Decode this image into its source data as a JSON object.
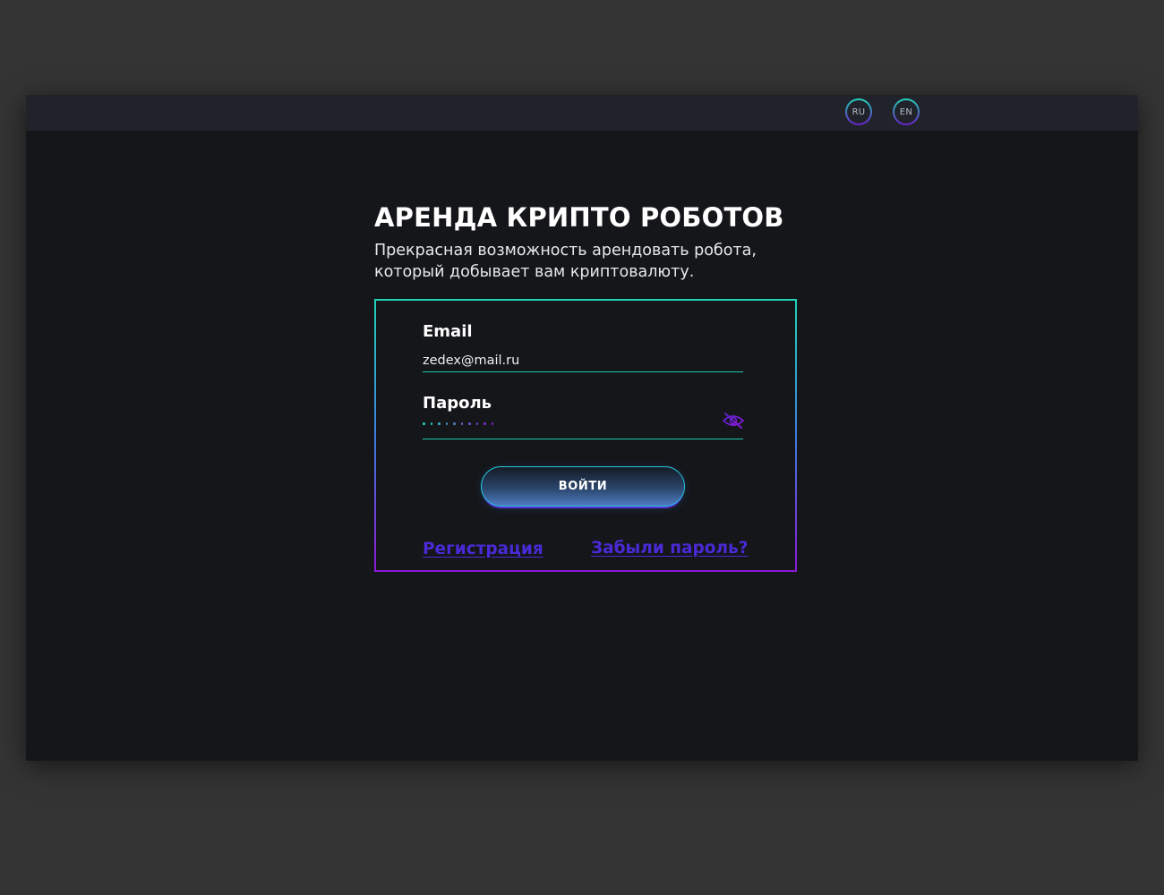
{
  "header": {
    "languages": [
      "RU",
      "EN"
    ]
  },
  "hero": {
    "title": "АРЕНДА КРИПТО РОБОТОВ",
    "subtitle_line1": "Прекрасная возможность арендовать робота,",
    "subtitle_line2": "который добывает вам криптовалюту."
  },
  "form": {
    "email_label": "Email",
    "email_value": "zedex@mail.ru",
    "password_label": "Пароль",
    "password_value": "••••••••••",
    "password_masked_length": 10,
    "toggle_visibility_icon": "eye-slash-icon",
    "submit_label": "ВОЙТИ",
    "register_link": "Регистрация",
    "forgot_link": "Забыли пароль?"
  },
  "colors": {
    "page_bg": "#343434",
    "app_bg": "#141619",
    "topbar_bg": "#20232a",
    "accent_teal": "#22d3b8",
    "accent_purple": "#8c17d6",
    "link_color": "#4a2ad6"
  }
}
